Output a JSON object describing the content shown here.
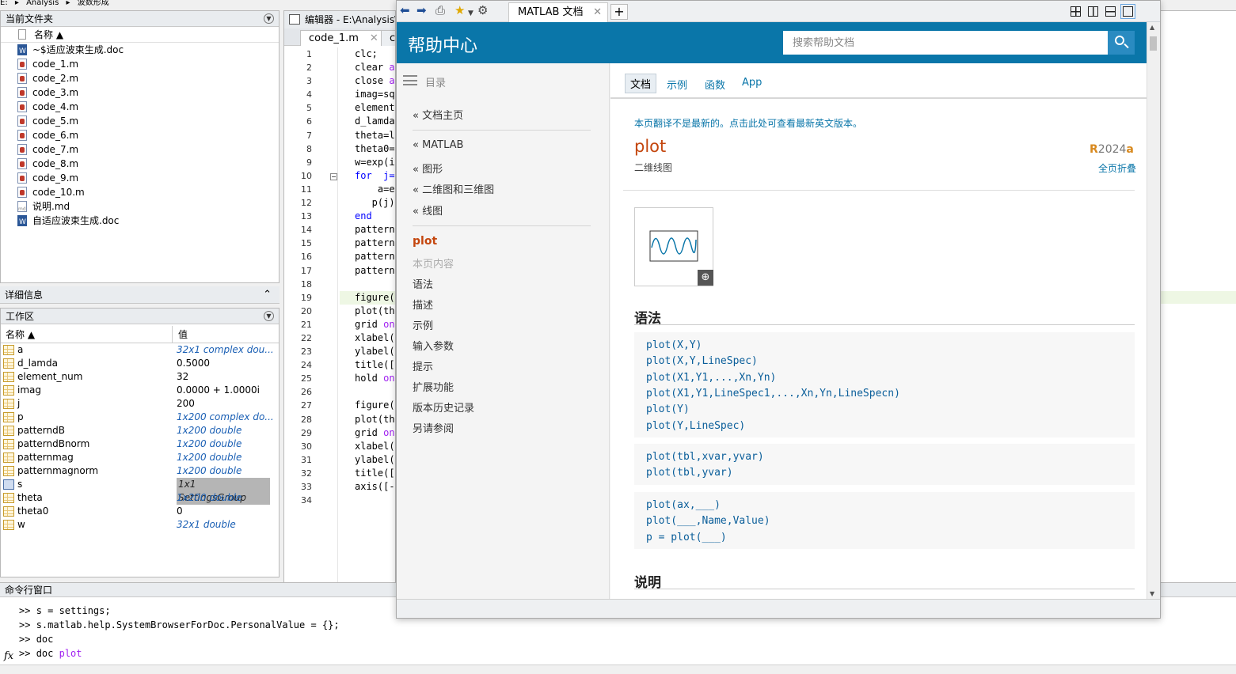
{
  "address_bar": {
    "segments": [
      "E:",
      "Analysis",
      "波数形成"
    ]
  },
  "current_folder": {
    "title": "当前文件夹",
    "column_name": "名称 ▲",
    "files": [
      {
        "name": "~$适应波束生成.doc",
        "type": "doc"
      },
      {
        "name": "code_1.m",
        "type": "m"
      },
      {
        "name": "code_2.m",
        "type": "m"
      },
      {
        "name": "code_3.m",
        "type": "m"
      },
      {
        "name": "code_4.m",
        "type": "m"
      },
      {
        "name": "code_5.m",
        "type": "m"
      },
      {
        "name": "code_6.m",
        "type": "m"
      },
      {
        "name": "code_7.m",
        "type": "m"
      },
      {
        "name": "code_8.m",
        "type": "m"
      },
      {
        "name": "code_9.m",
        "type": "m"
      },
      {
        "name": "code_10.m",
        "type": "m"
      },
      {
        "name": "说明.md",
        "type": "md"
      },
      {
        "name": "自适应波束生成.doc",
        "type": "doc"
      }
    ]
  },
  "details": {
    "title": "详细信息"
  },
  "workspace": {
    "title": "工作区",
    "col_name": "名称 ▲",
    "col_value": "值",
    "vars": [
      {
        "name": "a",
        "value": "32x1 complex dou...",
        "italic": true
      },
      {
        "name": "d_lamda",
        "value": "0.5000",
        "italic": false
      },
      {
        "name": "element_num",
        "value": "32",
        "italic": false
      },
      {
        "name": "imag",
        "value": "0.0000 + 1.0000i",
        "italic": false
      },
      {
        "name": "j",
        "value": "200",
        "italic": false
      },
      {
        "name": "p",
        "value": "1x200 complex do...",
        "italic": true
      },
      {
        "name": "patterndB",
        "value": "1x200 double",
        "italic": true
      },
      {
        "name": "patterndBnorm",
        "value": "1x200 double",
        "italic": true
      },
      {
        "name": "patternmag",
        "value": "1x200 double",
        "italic": true
      },
      {
        "name": "patternmagnorm",
        "value": "1x200 double",
        "italic": true
      },
      {
        "name": "s",
        "value": "1x1 SettingsGroup",
        "italic": true,
        "selected": true
      },
      {
        "name": "theta",
        "value": "1x200 double",
        "italic": true
      },
      {
        "name": "theta0",
        "value": "0",
        "italic": false
      },
      {
        "name": "w",
        "value": "32x1 double",
        "italic": true
      }
    ]
  },
  "editor": {
    "title": "编辑器 - E:\\Analysis\\",
    "tab_active": "code_1.m",
    "tab_next": "co",
    "lines": [
      {
        "n": "1",
        "text": "clc;"
      },
      {
        "n": "2",
        "text": "clear a"
      },
      {
        "n": "3",
        "text": "close a"
      },
      {
        "n": "4",
        "text": "imag=sq"
      },
      {
        "n": "5",
        "text": "element"
      },
      {
        "n": "6",
        "text": "d_lamda"
      },
      {
        "n": "7",
        "text": "theta=l"
      },
      {
        "n": "8",
        "text": "theta0="
      },
      {
        "n": "9",
        "text": "w=exp(i"
      },
      {
        "n": "10",
        "text": "for  j="
      },
      {
        "n": "11",
        "text": "    a=e"
      },
      {
        "n": "12",
        "text": "   p(j)"
      },
      {
        "n": "13",
        "text": "end"
      },
      {
        "n": "14",
        "text": "pattern"
      },
      {
        "n": "15",
        "text": "pattern"
      },
      {
        "n": "16",
        "text": "pattern"
      },
      {
        "n": "17",
        "text": "pattern"
      },
      {
        "n": "18",
        "text": ""
      },
      {
        "n": "19",
        "text": "figure("
      },
      {
        "n": "20",
        "text": "plot(th"
      },
      {
        "n": "21",
        "text": "grid on"
      },
      {
        "n": "22",
        "text": "xlabel("
      },
      {
        "n": "23",
        "text": "ylabel("
      },
      {
        "n": "24",
        "text": "title(["
      },
      {
        "n": "25",
        "text": "hold on"
      },
      {
        "n": "26",
        "text": ""
      },
      {
        "n": "27",
        "text": "figure("
      },
      {
        "n": "28",
        "text": "plot(th"
      },
      {
        "n": "29",
        "text": "grid on"
      },
      {
        "n": "30",
        "text": "xlabel("
      },
      {
        "n": "31",
        "text": "ylabel("
      },
      {
        "n": "32",
        "text": "title(["
      },
      {
        "n": "33",
        "text": "axis([-"
      },
      {
        "n": "34",
        "text": ""
      }
    ]
  },
  "command_window": {
    "title": "命令行窗口",
    "lines": [
      {
        "prompt": ">> ",
        "text": "s = settings;",
        "arg": ""
      },
      {
        "prompt": ">> ",
        "text": "s.matlab.help.SystemBrowserForDoc.PersonalValue = {};",
        "arg": ""
      },
      {
        "prompt": ">> ",
        "text": "doc",
        "arg": ""
      },
      {
        "prompt": ">> ",
        "text": "doc ",
        "arg": "plot"
      }
    ],
    "fx": "fx"
  },
  "help": {
    "tab_label": "MATLAB 文档",
    "header_title": "帮助中心",
    "search_placeholder": "搜索帮助文档",
    "nav": {
      "toc_label": "目录",
      "doc_home": "« 文档主页",
      "crumbs": [
        "« MATLAB",
        "« 图形",
        "« 二维图和三维图",
        "« 线图"
      ],
      "current": "plot",
      "on_this_page": "本页内容",
      "sections": [
        "语法",
        "描述",
        "示例",
        "输入参数",
        "提示",
        "扩展功能",
        "版本历史记录",
        "另请参阅"
      ]
    },
    "content_tabs": [
      "文档",
      "示例",
      "函数",
      "App"
    ],
    "notice": "本页翻译不是最新的。点击此处可查看最新英文版本。",
    "page_title": "plot",
    "page_subtitle": "二维线图",
    "release_r": "R",
    "release_num": "2024",
    "release_a": "a",
    "collapse_all": "全页折叠",
    "syntax_heading": "语法",
    "syntax_groups": [
      [
        "plot(X,Y)",
        "plot(X,Y,LineSpec)",
        "plot(X1,Y1,...,Xn,Yn)",
        "plot(X1,Y1,LineSpec1,...,Xn,Yn,LineSpecn)",
        "plot(Y)",
        "plot(Y,LineSpec)"
      ],
      [
        "plot(tbl,xvar,yvar)",
        "plot(tbl,yvar)"
      ],
      [
        "plot(ax,___)",
        "plot(___,Name,Value)",
        "p = plot(___)"
      ]
    ],
    "description_heading": "说明"
  }
}
